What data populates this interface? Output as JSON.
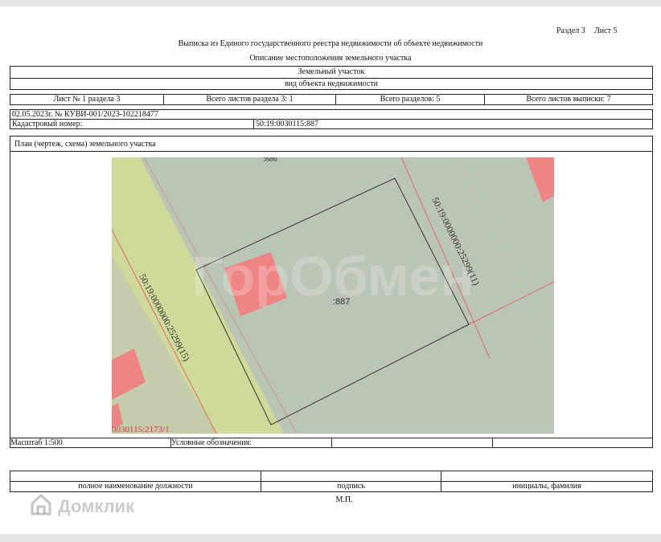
{
  "header": {
    "section": "Раздел 3",
    "sheet": "Лист 5",
    "title": "Выписка из Единого государственного реестра недвижимости об объекте недвижимости",
    "subtitle": "Описание местоположения земельного участка"
  },
  "object": {
    "type": "Земельный участок",
    "type_caption": "вид объекта недвижимости"
  },
  "sheets_row": {
    "sheet_no": "Лист № 1 раздела 3",
    "total_section_sheets": "Всего листов раздела 3: 1",
    "total_sections": "Всего разделов: 5",
    "total_extract_sheets": "Всего листов выписки: 7"
  },
  "doc_ref": "02.05.2023г. № КУВИ-001/2023-102218477",
  "cadastral": {
    "label": "Кадастровый номер:",
    "value": "50:19:0030115:887"
  },
  "plan_title": "План (чертеж, схема) земельного участка",
  "map": {
    "labels": {
      "parcel": ":887",
      "top_partial": ":886",
      "boundary_right": "50:19:0000000:25299(11)",
      "boundary_left": "50:19:0000000:25299(15)",
      "bottom_left": "0030115:2173/1"
    },
    "watermark": "ГорОбмен",
    "colors": {
      "road": "#cfd99a",
      "parcel_area": "#bac5b5",
      "building": "#ee8585",
      "line": "#333333",
      "red_line": "#e06a6a"
    }
  },
  "legend_row": {
    "scale": "Масштаб 1:500",
    "legend_label": "Условные обозначения:"
  },
  "signature": {
    "position": "полное наименование должности",
    "signature": "подпись",
    "name": "инициалы, фамилия",
    "stamp": "М.П."
  },
  "brand": {
    "name": "Домклик",
    "icon": "house-logo-icon"
  }
}
